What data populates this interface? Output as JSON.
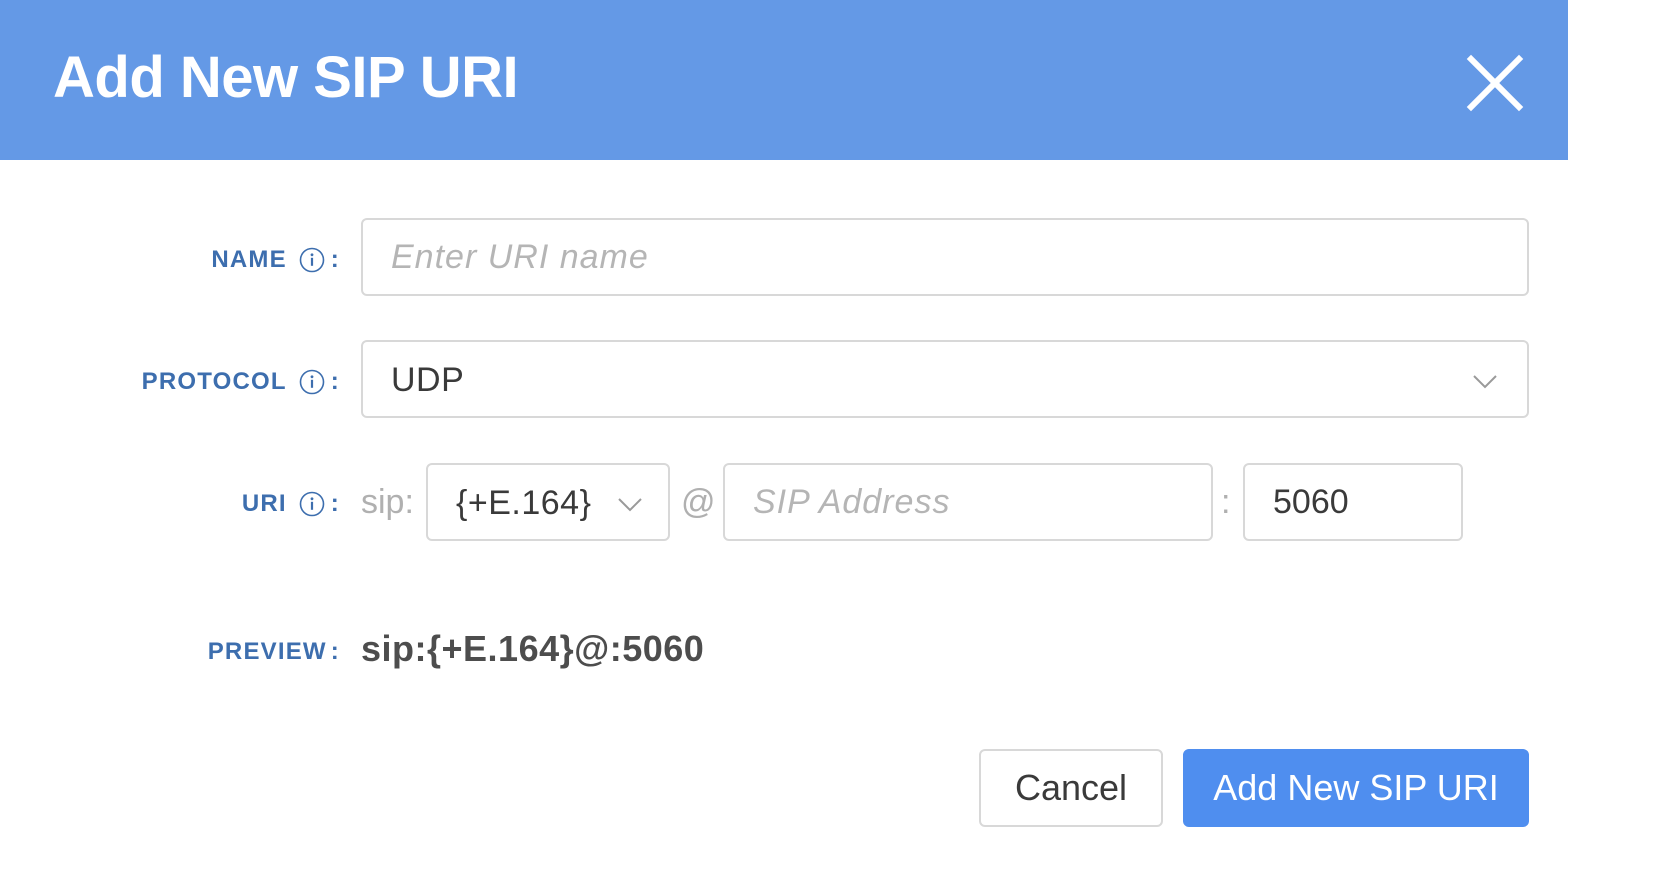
{
  "dialog": {
    "title": "Add New SIP URI",
    "close_icon": "close-icon"
  },
  "form": {
    "name": {
      "label": "NAME",
      "colon": ":",
      "info_icon": "info-icon",
      "value": "",
      "placeholder": "Enter URI name"
    },
    "protocol": {
      "label": "PROTOCOL",
      "colon": ":",
      "info_icon": "info-icon",
      "selected": "UDP",
      "dropdown_icon": "chevron-down-icon"
    },
    "uri": {
      "label": "URI",
      "colon": ":",
      "info_icon": "info-icon",
      "scheme": "sip:",
      "user_part_selected": "{+E.164}",
      "at_sign": "@",
      "address_value": "",
      "address_placeholder": "SIP Address",
      "port_separator": ":",
      "port_value": "5060"
    },
    "preview": {
      "label": "PREVIEW",
      "colon": ":",
      "value": "sip:{+E.164}@:5060"
    }
  },
  "actions": {
    "cancel_label": "Cancel",
    "submit_label": "Add New SIP URI"
  },
  "colors": {
    "header_bg": "#6499e6",
    "label": "#3d6eae",
    "primary_button": "#4f8eef"
  }
}
